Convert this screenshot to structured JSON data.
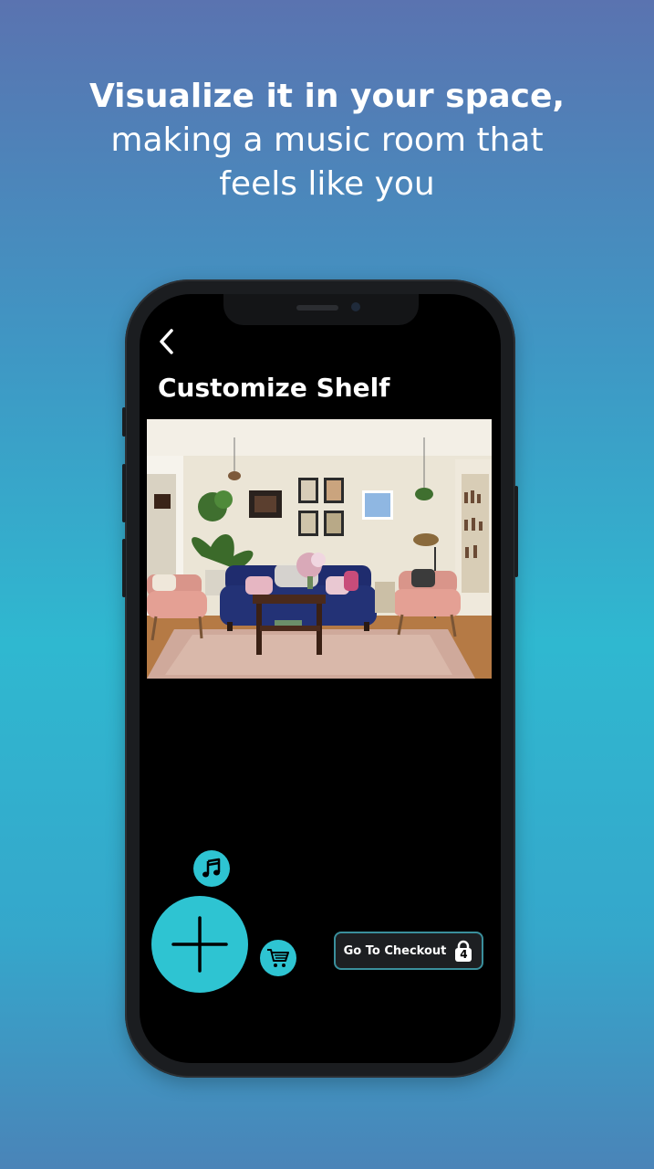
{
  "promo": {
    "headline_bold": "Visualize it in your space,",
    "headline_line2": "making a music room that",
    "headline_line3": "feels like you"
  },
  "screen": {
    "title": "Customize Shelf",
    "back_icon": "chevron-left-icon",
    "checkout": {
      "label": "Go To Checkout",
      "cart_count": "4",
      "icon": "lock-icon"
    },
    "fab_add_icon": "plus-icon",
    "music_icon": "music-note-icon",
    "cart_icon": "cart-icon"
  },
  "colors": {
    "accent": "#2ec4d2",
    "screen_bg": "#000000",
    "checkout_bg": "#1d1f22",
    "checkout_border": "#3a8f9c"
  }
}
